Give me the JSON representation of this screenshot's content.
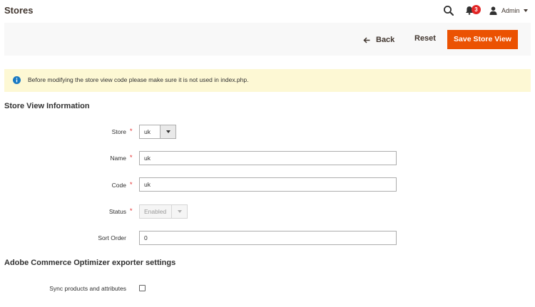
{
  "header": {
    "title": "Stores",
    "notification_count": "3",
    "user_name": "Admin"
  },
  "actions": {
    "back_label": "Back",
    "reset_label": "Reset",
    "save_label": "Save Store View"
  },
  "notice": {
    "text": "Before modifying the store view code please make sure it is not used in index.php."
  },
  "store_view_information": {
    "title": "Store View Information",
    "store": {
      "label": "Store",
      "value": "uk"
    },
    "name": {
      "label": "Name",
      "value": "uk"
    },
    "code": {
      "label": "Code",
      "value": "uk"
    },
    "status": {
      "label": "Status",
      "value": "Enabled"
    },
    "sort_order": {
      "label": "Sort Order",
      "value": "0"
    }
  },
  "exporter": {
    "title": "Adobe Commerce Optimizer exporter settings",
    "sync": {
      "label": "Sync products and attributes",
      "checked": false
    }
  },
  "colors": {
    "primary_button": "#eb5202",
    "notice_background": "#fdf8d4",
    "required_marker": "#e22626",
    "badge": "#e22626"
  },
  "icons": [
    "search-icon",
    "bell-icon",
    "user-icon",
    "chevron-down-icon",
    "arrow-left-icon",
    "info-icon"
  ]
}
